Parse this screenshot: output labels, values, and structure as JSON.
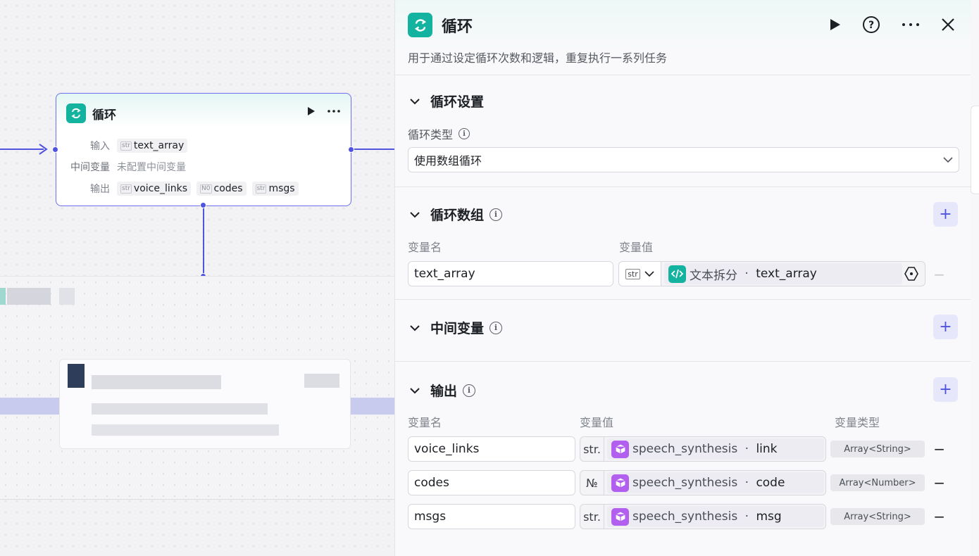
{
  "canvas": {
    "loop_node": {
      "title": "循环",
      "input_label": "输入",
      "input_chip": {
        "type": "str",
        "name": "text_array"
      },
      "intermediate_label": "中间变量",
      "intermediate_value": "未配置中间变量",
      "output_label": "输出",
      "output_chips": [
        {
          "type": "str",
          "name": "voice_links"
        },
        {
          "type": "N0",
          "name": "codes"
        },
        {
          "type": "str",
          "name": "msgs"
        }
      ]
    }
  },
  "panel": {
    "title": "循环",
    "description": "用于通过设定循环次数和逻辑，重复执行一系列任务",
    "loop_settings": {
      "title": "循环设置",
      "type_label": "循环类型",
      "type_value": "使用数组循环"
    },
    "loop_array": {
      "title": "循环数组",
      "col_name": "变量名",
      "col_value": "变量值",
      "row": {
        "name": "text_array",
        "type_icon": "str",
        "source_node": "文本拆分",
        "separator": " · ",
        "source_field": "text_array"
      }
    },
    "intermediate": {
      "title": "中间变量"
    },
    "output": {
      "title": "输出",
      "col_name": "变量名",
      "col_value": "变量值",
      "col_type": "变量类型",
      "rows": [
        {
          "name": "voice_links",
          "type_icon": "str.",
          "source_node": "speech_synthesis",
          "separator": " · ",
          "source_field": "link",
          "var_type": "Array<String>"
        },
        {
          "name": "codes",
          "type_icon": "№",
          "source_node": "speech_synthesis",
          "separator": " · ",
          "source_field": "code",
          "var_type": "Array<Number>"
        },
        {
          "name": "msgs",
          "type_icon": "str.",
          "source_node": "speech_synthesis",
          "separator": " · ",
          "source_field": "msg",
          "var_type": "Array<String>"
        }
      ]
    }
  },
  "colors": {
    "accent": "#4f53e0",
    "loop_icon": "#13b3a0",
    "plugin_icon": "#b25ff0"
  }
}
